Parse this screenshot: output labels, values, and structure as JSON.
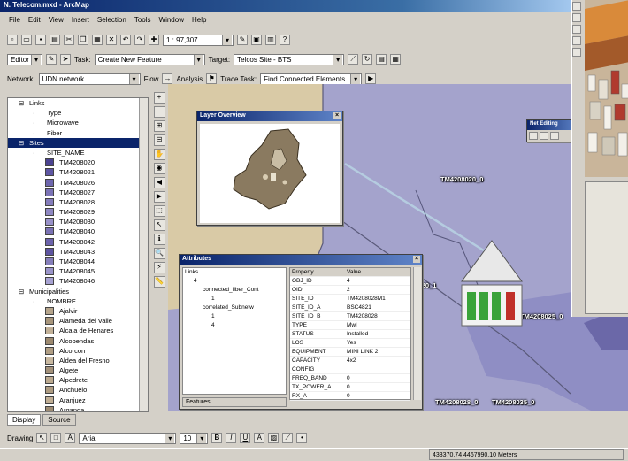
{
  "window": {
    "title": "N. Telecom.mxd - ArcMap"
  },
  "menu": [
    "File",
    "Edit",
    "View",
    "Insert",
    "Selection",
    "Tools",
    "Window",
    "Help"
  ],
  "toolbar": {
    "scale": "1 : 97,307"
  },
  "editor": {
    "editor_label": "Editor",
    "task_label": "Task:",
    "task_value": "Create New Feature",
    "target_label": "Target:",
    "target_value": "Telcos Site - BTS"
  },
  "network": {
    "label": "Network:",
    "value": "UDN network",
    "flow_label": "Flow",
    "analysis_label": "Analysis",
    "trace_label": "Trace Task:",
    "trace_value": "Find Connected Elements"
  },
  "toc": {
    "rows": [
      {
        "indent": 1,
        "text": "Links",
        "swatch": null
      },
      {
        "indent": 3,
        "text": "Type",
        "swatch": null
      },
      {
        "indent": 3,
        "text": "Microwave",
        "swatch": null
      },
      {
        "indent": 3,
        "text": "Fiber",
        "swatch": null
      },
      {
        "indent": 1,
        "text": "Sites",
        "swatch": null,
        "selected": true
      },
      {
        "indent": 3,
        "text": "SITE_NAME",
        "swatch": null
      },
      {
        "indent": 2,
        "text": "TM4208020",
        "swatch": "#4b4391"
      },
      {
        "indent": 2,
        "text": "TM4208021",
        "swatch": "#5e56a3"
      },
      {
        "indent": 2,
        "text": "TM4208026",
        "swatch": "#6e66ae"
      },
      {
        "indent": 2,
        "text": "TM4208027",
        "swatch": "#7b73b6"
      },
      {
        "indent": 2,
        "text": "TM4208028",
        "swatch": "#847cbb"
      },
      {
        "indent": 2,
        "text": "TM4208029",
        "swatch": "#8e87c2"
      },
      {
        "indent": 2,
        "text": "TM4208030",
        "swatch": "#9891c8"
      },
      {
        "indent": 2,
        "text": "TM4208040",
        "swatch": "#7a72b4"
      },
      {
        "indent": 2,
        "text": "TM4208042",
        "swatch": "#6c63ac"
      },
      {
        "indent": 2,
        "text": "TM4208043",
        "swatch": "#5d54a0"
      },
      {
        "indent": 2,
        "text": "TM4208044",
        "swatch": "#857eba"
      },
      {
        "indent": 2,
        "text": "TM4208045",
        "swatch": "#9a94c9"
      },
      {
        "indent": 2,
        "text": "TM4208046",
        "swatch": "#a7a2d2"
      },
      {
        "indent": 1,
        "text": "Municipalities",
        "swatch": null
      },
      {
        "indent": 3,
        "text": "NOMBRE",
        "swatch": null
      },
      {
        "indent": 2,
        "text": "Ajalvir",
        "swatch": "#b6a58c"
      },
      {
        "indent": 2,
        "text": "Alameda del Valle",
        "swatch": "#a8967c"
      },
      {
        "indent": 2,
        "text": "Alcala de Henares",
        "swatch": "#c2b198"
      },
      {
        "indent": 2,
        "text": "Alcobendas",
        "swatch": "#9d8a70"
      },
      {
        "indent": 2,
        "text": "Alcorcon",
        "swatch": "#b09e84"
      },
      {
        "indent": 2,
        "text": "Aldea del Fresno",
        "swatch": "#c8b8a0"
      },
      {
        "indent": 2,
        "text": "Algete",
        "swatch": "#a3917a"
      },
      {
        "indent": 2,
        "text": "Alpedrete",
        "swatch": "#bba98f"
      },
      {
        "indent": 2,
        "text": "Anchuelo",
        "swatch": "#ad9b81"
      },
      {
        "indent": 2,
        "text": "Aranjuez",
        "swatch": "#c0ae94"
      },
      {
        "indent": 2,
        "text": "Arganda",
        "swatch": "#9e8c73"
      }
    ]
  },
  "tabs": [
    "Display",
    "Source"
  ],
  "overview": {
    "title": "Layer Overview"
  },
  "identify": {
    "title": "Attributes",
    "tree": [
      "Links",
      "4",
      "connected_fiber_Cont",
      "1",
      "correlated_Subnetw",
      "1",
      "4"
    ],
    "headers": [
      "Property",
      "Value"
    ],
    "rows": [
      [
        "OBJ_ID",
        "4"
      ],
      [
        "OID",
        "2"
      ],
      [
        "SITE_ID",
        "TM4208028M1"
      ],
      [
        "SITE_ID_A",
        "BSC4821"
      ],
      [
        "SITE_ID_B",
        "TM4208028"
      ],
      [
        "TYPE",
        "Mwl"
      ],
      [
        "STATUS",
        "Installed"
      ],
      [
        "LOS",
        "Yes"
      ],
      [
        "EQUIPMENT",
        "MINI LINK 2"
      ],
      [
        "CAPACITY",
        "4x2"
      ],
      [
        "CONFIG",
        ""
      ],
      [
        "FREQ_BAND",
        "0"
      ],
      [
        "TX_POWER_A",
        "0"
      ],
      [
        "RX_A",
        "0"
      ]
    ],
    "footer": "Features"
  },
  "map_labels": [
    "TM4208020_0",
    "TM4208020_1",
    "TM4208025_0",
    "TM4208028_0",
    "TM4208035_0"
  ],
  "network_toolbar_title": "Net Editing",
  "drawing": {
    "label": "Drawing",
    "font": "Arial",
    "size": "10"
  },
  "status": {
    "coords": "433370.74 4467990.10 Meters"
  }
}
